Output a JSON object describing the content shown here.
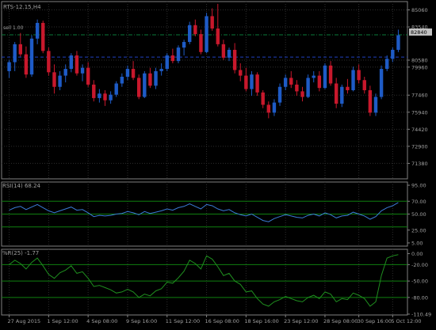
{
  "colors": {
    "background": "#000000",
    "bull": "#1e5bc6",
    "bear": "#c8182c",
    "panel_border": "#808080",
    "axis_text": "#a0a0a0",
    "grid": "#2e2e2e",
    "rsi_line": "#3a7bd5",
    "wpr_line": "#1f8f1f",
    "level_line": "#0f7f0f",
    "sl_line": "#0a7a3a",
    "bid_line": "#2040c0",
    "price_tag_bg": "#c0c0c0"
  },
  "main": {
    "title": "RTS-12.15,H4",
    "sl_label": "sell 1.00",
    "price_tag": "82840",
    "sl_level": 82840,
    "bid_level": 80850
  },
  "rsi": {
    "title": "RSI(14) 68.24",
    "levels": [
      70,
      50,
      30
    ]
  },
  "wpr": {
    "title": "%R(25) -1.77",
    "levels": [
      -20,
      -50,
      -80
    ]
  },
  "chart_data": [
    {
      "type": "candlestick",
      "title": "RTS-12.15,H4",
      "ylim": [
        70000,
        85800
      ],
      "ticks": [
        {
          "value": 85060,
          "label": "85060"
        },
        {
          "value": 83540,
          "label": "83540"
        },
        {
          "value": 82840,
          "label": "82840"
        },
        {
          "value": 80580,
          "label": "80580"
        },
        {
          "value": 79960,
          "label": "79960"
        },
        {
          "value": 77460,
          "label": "77460"
        },
        {
          "value": 75940,
          "label": "75940"
        },
        {
          "value": 74420,
          "label": "74420"
        },
        {
          "value": 72900,
          "label": "72900"
        },
        {
          "value": 71380,
          "label": "71380"
        }
      ],
      "ohlc": [
        [
          79600,
          80600,
          79000,
          80400
        ],
        [
          80400,
          82200,
          79600,
          82000
        ],
        [
          82000,
          83000,
          80900,
          81100
        ],
        [
          81100,
          81800,
          79000,
          79300
        ],
        [
          79300,
          82800,
          79100,
          82500
        ],
        [
          82500,
          84200,
          82000,
          83900
        ],
        [
          83900,
          84100,
          81200,
          81400
        ],
        [
          81400,
          81700,
          79200,
          79500
        ],
        [
          79500,
          80200,
          77600,
          78200
        ],
        [
          78200,
          79600,
          77900,
          79200
        ],
        [
          79200,
          80200,
          78600,
          79800
        ],
        [
          79800,
          81200,
          79500,
          81000
        ],
        [
          81000,
          81400,
          79200,
          79400
        ],
        [
          79400,
          80200,
          78700,
          79900
        ],
        [
          79900,
          80400,
          78200,
          78400
        ],
        [
          78400,
          78800,
          76900,
          77200
        ],
        [
          77200,
          78000,
          76800,
          77600
        ],
        [
          77600,
          77900,
          76500,
          77000
        ],
        [
          77000,
          77800,
          76700,
          77500
        ],
        [
          77500,
          78700,
          77300,
          78500
        ],
        [
          78500,
          79400,
          78200,
          79100
        ],
        [
          79100,
          80100,
          78800,
          79800
        ],
        [
          79800,
          80500,
          78800,
          79000
        ],
        [
          79000,
          79300,
          77100,
          77300
        ],
        [
          77300,
          79600,
          77200,
          79400
        ],
        [
          79400,
          79900,
          78100,
          78300
        ],
        [
          78300,
          79900,
          78000,
          79600
        ],
        [
          79600,
          80300,
          79200,
          79800
        ],
        [
          79800,
          81200,
          79600,
          81000
        ],
        [
          81000,
          81600,
          80300,
          80500
        ],
        [
          80500,
          81900,
          80300,
          81700
        ],
        [
          81700,
          82400,
          81000,
          82200
        ],
        [
          82200,
          84000,
          82000,
          83700
        ],
        [
          83700,
          84200,
          82700,
          82900
        ],
        [
          82900,
          83300,
          81100,
          81300
        ],
        [
          81300,
          84800,
          81200,
          84500
        ],
        [
          84500,
          85200,
          83200,
          83400
        ],
        [
          83400,
          85600,
          81800,
          82000
        ],
        [
          82000,
          82400,
          80600,
          80800
        ],
        [
          80800,
          81700,
          80500,
          81500
        ],
        [
          81500,
          82100,
          79400,
          79700
        ],
        [
          79700,
          80300,
          78700,
          79200
        ],
        [
          79200,
          79900,
          77800,
          78000
        ],
        [
          78000,
          79600,
          77400,
          79300
        ],
        [
          79300,
          79500,
          77400,
          77700
        ],
        [
          77700,
          77900,
          76300,
          76600
        ],
        [
          76600,
          76900,
          75400,
          75900
        ],
        [
          75900,
          77100,
          75600,
          76800
        ],
        [
          76800,
          78500,
          76500,
          78200
        ],
        [
          78200,
          79300,
          77900,
          79000
        ],
        [
          79000,
          79600,
          78100,
          78400
        ],
        [
          78400,
          78800,
          77400,
          77800
        ],
        [
          77800,
          78200,
          76900,
          77300
        ],
        [
          77300,
          79300,
          77200,
          79000
        ],
        [
          79000,
          79600,
          78600,
          79200
        ],
        [
          79200,
          79600,
          77800,
          78100
        ],
        [
          78100,
          80300,
          78000,
          80100
        ],
        [
          80100,
          80500,
          78300,
          78500
        ],
        [
          78500,
          79000,
          76300,
          76700
        ],
        [
          76700,
          78400,
          76400,
          78200
        ],
        [
          78200,
          78900,
          77600,
          77900
        ],
        [
          77900,
          80000,
          77800,
          79700
        ],
        [
          79700,
          80200,
          78500,
          78800
        ],
        [
          78800,
          79100,
          77600,
          77900
        ],
        [
          77900,
          78300,
          75600,
          75900
        ],
        [
          75900,
          77600,
          75600,
          77300
        ],
        [
          77300,
          80100,
          77100,
          79800
        ],
        [
          79800,
          81000,
          79600,
          80700
        ],
        [
          80700,
          81700,
          80400,
          81500
        ],
        [
          81500,
          83300,
          81300,
          82800
        ]
      ],
      "xticks": [
        "27 Aug 2015",
        "1 Sep 12:00",
        "4 Sep 08:00",
        "9 Sep 16:00",
        "11 Sep 12:00",
        "16 Sep 08:00",
        "18 Sep 16:00",
        "23 Sep 12:00",
        "28 Sep 08:00",
        "30 Sep 16:00",
        "5 Oct 12:00"
      ],
      "xtick_index": [
        0,
        7,
        14,
        21,
        28,
        35,
        42,
        49,
        56,
        62,
        68
      ]
    },
    {
      "type": "line",
      "title": "RSI(14) 68.24",
      "ylim": [
        0,
        100
      ],
      "ticks": [
        {
          "value": 95,
          "label": "95.00"
        },
        {
          "value": 70,
          "label": "70.00"
        },
        {
          "value": 50,
          "label": "50.00"
        },
        {
          "value": 25,
          "label": "25.00"
        },
        {
          "value": 5,
          "label": "5.00"
        }
      ],
      "series": [
        {
          "values": [
            56,
            60,
            62,
            57,
            61,
            65,
            60,
            55,
            52,
            55,
            58,
            61,
            56,
            57,
            52,
            46,
            48,
            47,
            48,
            50,
            51,
            54,
            52,
            49,
            54,
            51,
            53,
            55,
            58,
            56,
            60,
            62,
            66,
            62,
            58,
            65,
            63,
            58,
            55,
            57,
            52,
            49,
            47,
            50,
            45,
            40,
            38,
            43,
            46,
            49,
            47,
            45,
            44,
            48,
            50,
            47,
            52,
            49,
            44,
            47,
            48,
            53,
            50,
            47,
            42,
            46,
            55,
            60,
            63,
            68
          ]
        }
      ]
    },
    {
      "type": "line",
      "title": "%R(25) -1.77",
      "ylim": [
        -112,
        8
      ],
      "ticks": [
        {
          "value": 0,
          "label": "0.00"
        },
        {
          "value": -20,
          "label": "-20.00"
        },
        {
          "value": -50,
          "label": "-50.00"
        },
        {
          "value": -80,
          "label": "-80.00"
        },
        {
          "value": -110.49,
          "label": "-110.49"
        }
      ],
      "series": [
        {
          "values": [
            -20,
            -12,
            -18,
            -28,
            -16,
            -8,
            -22,
            -38,
            -45,
            -35,
            -30,
            -22,
            -36,
            -33,
            -45,
            -60,
            -58,
            -62,
            -66,
            -72,
            -70,
            -65,
            -70,
            -80,
            -74,
            -77,
            -68,
            -64,
            -52,
            -54,
            -44,
            -32,
            -12,
            -18,
            -28,
            -4,
            -10,
            -24,
            -40,
            -36,
            -50,
            -56,
            -70,
            -68,
            -82,
            -92,
            -96,
            -88,
            -84,
            -78,
            -82,
            -86,
            -88,
            -80,
            -76,
            -82,
            -70,
            -74,
            -88,
            -82,
            -84,
            -72,
            -76,
            -82,
            -96,
            -88,
            -40,
            -8,
            -4,
            -1.77
          ]
        }
      ]
    }
  ]
}
